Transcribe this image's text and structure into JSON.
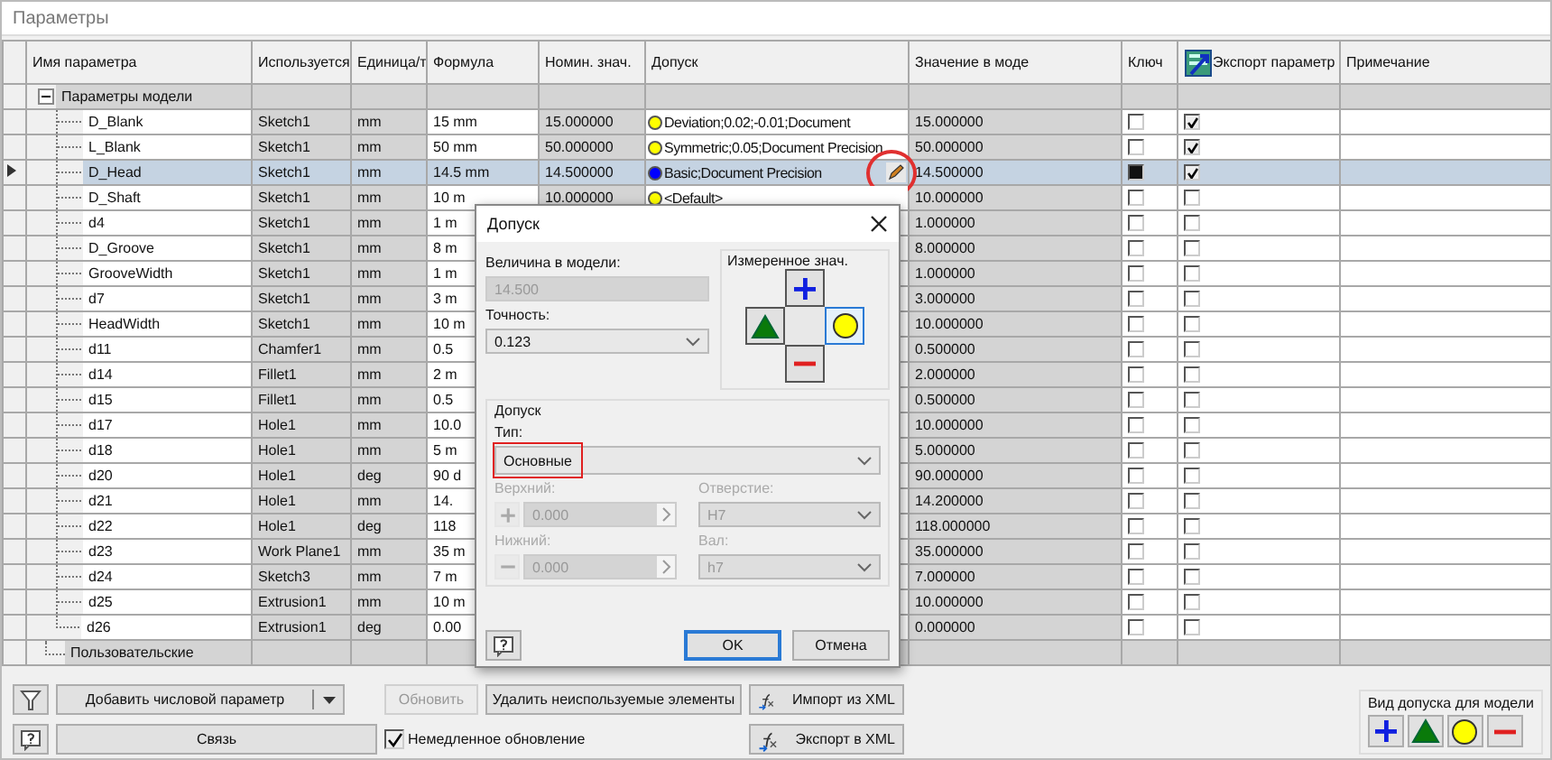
{
  "window": {
    "title": "Параметры"
  },
  "table": {
    "columns": [
      "Имя параметра",
      "Используется",
      "Единица/т",
      "Формула",
      "Номин. знач.",
      "Допуск",
      "Значение в моде",
      "Ключ",
      "Экспорт параметр",
      "Примечание"
    ],
    "groups": [
      {
        "label": "Параметры модели",
        "expanded": true,
        "children": [
          {
            "name": "D_Blank",
            "used_by": "Sketch1",
            "unit": "mm",
            "formula": "15 mm",
            "nominal": "15.000000",
            "tolerance": {
              "color": "#ffff00",
              "text": "Deviation;0.02;-0.01;Document"
            },
            "model_value": "15.000000",
            "key": false,
            "export": true,
            "selected": false
          },
          {
            "name": "L_Blank",
            "used_by": "Sketch1",
            "unit": "mm",
            "formula": "50 mm",
            "nominal": "50.000000",
            "tolerance": {
              "color": "#ffff00",
              "text": "Symmetric;0.05;Document Precision"
            },
            "model_value": "50.000000",
            "key": false,
            "export": true,
            "selected": false
          },
          {
            "name": "D_Head",
            "used_by": "Sketch1",
            "unit": "mm",
            "formula": "14.5 mm",
            "nominal": "14.500000",
            "tolerance": {
              "color": "#0000ff",
              "text": "Basic;Document Precision",
              "edit_highlighted": true
            },
            "model_value": "14.500000",
            "key": true,
            "export": true,
            "selected": true
          },
          {
            "name": "D_Shaft",
            "used_by": "Sketch1",
            "unit": "mm",
            "formula": "10 m",
            "nominal": "10.000000",
            "tolerance": {
              "color": "#ffff00",
              "text": "<Default>"
            },
            "model_value": "10.000000",
            "key": false,
            "export": false,
            "selected": false
          },
          {
            "name": "d4",
            "used_by": "Sketch1",
            "unit": "mm",
            "formula": "1 m",
            "model_value": "1.000000",
            "key": false,
            "export": false,
            "selected": false
          },
          {
            "name": "D_Groove",
            "used_by": "Sketch1",
            "unit": "mm",
            "formula": "8 m",
            "model_value": "8.000000",
            "key": false,
            "export": false,
            "selected": false
          },
          {
            "name": "GrooveWidth",
            "used_by": "Sketch1",
            "unit": "mm",
            "formula": "1 m",
            "model_value": "1.000000",
            "key": false,
            "export": false,
            "selected": false
          },
          {
            "name": "d7",
            "used_by": "Sketch1",
            "unit": "mm",
            "formula": "3 m",
            "model_value": "3.000000",
            "key": false,
            "export": false,
            "selected": false
          },
          {
            "name": "HeadWidth",
            "used_by": "Sketch1",
            "unit": "mm",
            "formula": "10 m",
            "model_value": "10.000000",
            "key": false,
            "export": false,
            "selected": false
          },
          {
            "name": "d11",
            "used_by": "Chamfer1",
            "unit": "mm",
            "formula": "0.5",
            "model_value": "0.500000",
            "key": false,
            "export": false,
            "selected": false
          },
          {
            "name": "d14",
            "used_by": "Fillet1",
            "unit": "mm",
            "formula": "2 m",
            "model_value": "2.000000",
            "key": false,
            "export": false,
            "selected": false
          },
          {
            "name": "d15",
            "used_by": "Fillet1",
            "unit": "mm",
            "formula": "0.5",
            "model_value": "0.500000",
            "key": false,
            "export": false,
            "selected": false
          },
          {
            "name": "d17",
            "used_by": "Hole1",
            "unit": "mm",
            "formula": "10.0",
            "model_value": "10.000000",
            "key": false,
            "export": false,
            "selected": false
          },
          {
            "name": "d18",
            "used_by": "Hole1",
            "unit": "mm",
            "formula": "5 m",
            "model_value": "5.000000",
            "key": false,
            "export": false,
            "selected": false
          },
          {
            "name": "d20",
            "used_by": "Hole1",
            "unit": "deg",
            "formula": "90 d",
            "model_value": "90.000000",
            "key": false,
            "export": false,
            "selected": false
          },
          {
            "name": "d21",
            "used_by": "Hole1",
            "unit": "mm",
            "formula": "14.",
            "model_value": "14.200000",
            "key": false,
            "export": false,
            "selected": false
          },
          {
            "name": "d22",
            "used_by": "Hole1",
            "unit": "deg",
            "formula": "118",
            "model_value": "118.000000",
            "key": false,
            "export": false,
            "selected": false
          },
          {
            "name": "d23",
            "used_by": "Work Plane1",
            "unit": "mm",
            "formula": "35 m",
            "model_value": "35.000000",
            "key": false,
            "export": false,
            "selected": false
          },
          {
            "name": "d24",
            "used_by": "Sketch3",
            "unit": "mm",
            "formula": "7 m",
            "model_value": "7.000000",
            "key": false,
            "export": false,
            "selected": false
          },
          {
            "name": "d25",
            "used_by": "Extrusion1",
            "unit": "mm",
            "formula": "10 m",
            "model_value": "10.000000",
            "key": false,
            "export": false,
            "selected": false
          },
          {
            "name": "d26",
            "used_by": "Extrusion1",
            "unit": "deg",
            "formula": "0.00",
            "model_value": "0.000000",
            "key": false,
            "export": false,
            "selected": false
          }
        ]
      },
      {
        "label": "Пользовательские"
      }
    ]
  },
  "toolbar": {
    "add_button": "Добавить числовой параметр",
    "update_button": {
      "label": "Обновить",
      "disabled": true
    },
    "delete_button": "Удалить неиспользуемые элементы",
    "import_button": "Импорт из XML",
    "link_button": "Связь",
    "immediate_update": {
      "label": "Немедленное обновление",
      "checked": true
    },
    "export_button": "Экспорт в XML"
  },
  "model_tolerance": {
    "title": "Вид допуска для модели",
    "buttons": [
      {
        "kind": "plus"
      },
      {
        "kind": "triangle"
      },
      {
        "kind": "circle"
      },
      {
        "kind": "minus"
      }
    ]
  },
  "dialog": {
    "title": "Допуск",
    "model_value": {
      "label": "Величина в модели:",
      "value": "14.500",
      "disabled": true
    },
    "precision": {
      "label": "Точность:",
      "value": "0.123"
    },
    "measured": {
      "title": "Измеренное знач.",
      "buttons": [
        {
          "kind": "plus",
          "selected": false
        },
        {
          "kind": "triangle",
          "selected": false
        },
        {
          "kind": "circle",
          "selected": true
        },
        {
          "kind": "minus",
          "selected": false
        }
      ]
    },
    "tolerance_group": "Допуск",
    "type": {
      "label": "Тип:",
      "value": "Основные",
      "highlighted": true
    },
    "upper": {
      "label": "Верхний:",
      "value": "0.000",
      "disabled": true
    },
    "hole": {
      "label": "Отверстие:",
      "value": "H7",
      "disabled": true
    },
    "lower": {
      "label": "Нижний:",
      "value": "0.000",
      "disabled": true
    },
    "shaft": {
      "label": "Вал:",
      "value": "h7",
      "disabled": true
    },
    "buttons": [
      {
        "label": "OK",
        "default": true
      },
      {
        "label": "Отмена",
        "default": false
      }
    ]
  }
}
